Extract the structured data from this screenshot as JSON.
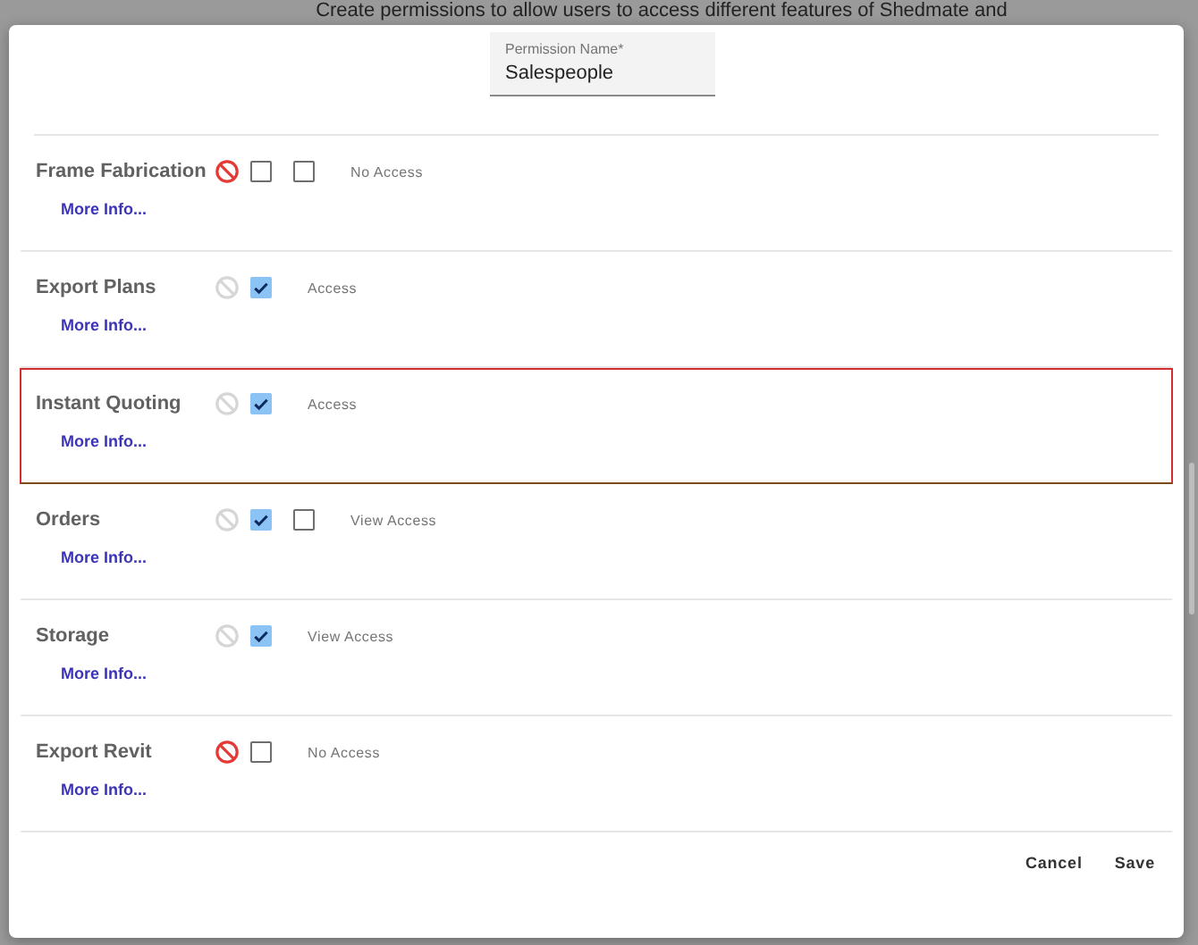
{
  "backdrop_text": "Create permissions to allow users to access different features of Shedmate and",
  "permission_name": {
    "label": "Permission Name*",
    "value": "Salespeople"
  },
  "permissions": [
    {
      "name": "Frame Fabrication",
      "no_access": true,
      "checkboxes": [
        {
          "checked": false
        },
        {
          "checked": false
        }
      ],
      "access_label": "No Access",
      "link": "More Info...",
      "highlighted": false
    },
    {
      "name": "Export Plans",
      "no_access": false,
      "checkboxes": [
        {
          "checked": true
        }
      ],
      "access_label": "Access",
      "link": "More Info...",
      "highlighted": false
    },
    {
      "name": "Instant Quoting",
      "no_access": false,
      "checkboxes": [
        {
          "checked": true
        }
      ],
      "access_label": "Access",
      "link": "More Info...",
      "highlighted": true
    },
    {
      "name": "Orders",
      "no_access": false,
      "checkboxes": [
        {
          "checked": true
        },
        {
          "checked": false
        }
      ],
      "access_label": "View Access",
      "link": "More Info...",
      "highlighted": false
    },
    {
      "name": "Storage",
      "no_access": false,
      "checkboxes": [
        {
          "checked": true
        }
      ],
      "access_label": "View Access",
      "link": "More Info...",
      "highlighted": false
    },
    {
      "name": "Export Revit",
      "no_access": true,
      "checkboxes": [
        {
          "checked": false
        }
      ],
      "access_label": "No Access",
      "link": "More Info...",
      "highlighted": false
    }
  ],
  "buttons": [
    "Cancel",
    "Save"
  ]
}
